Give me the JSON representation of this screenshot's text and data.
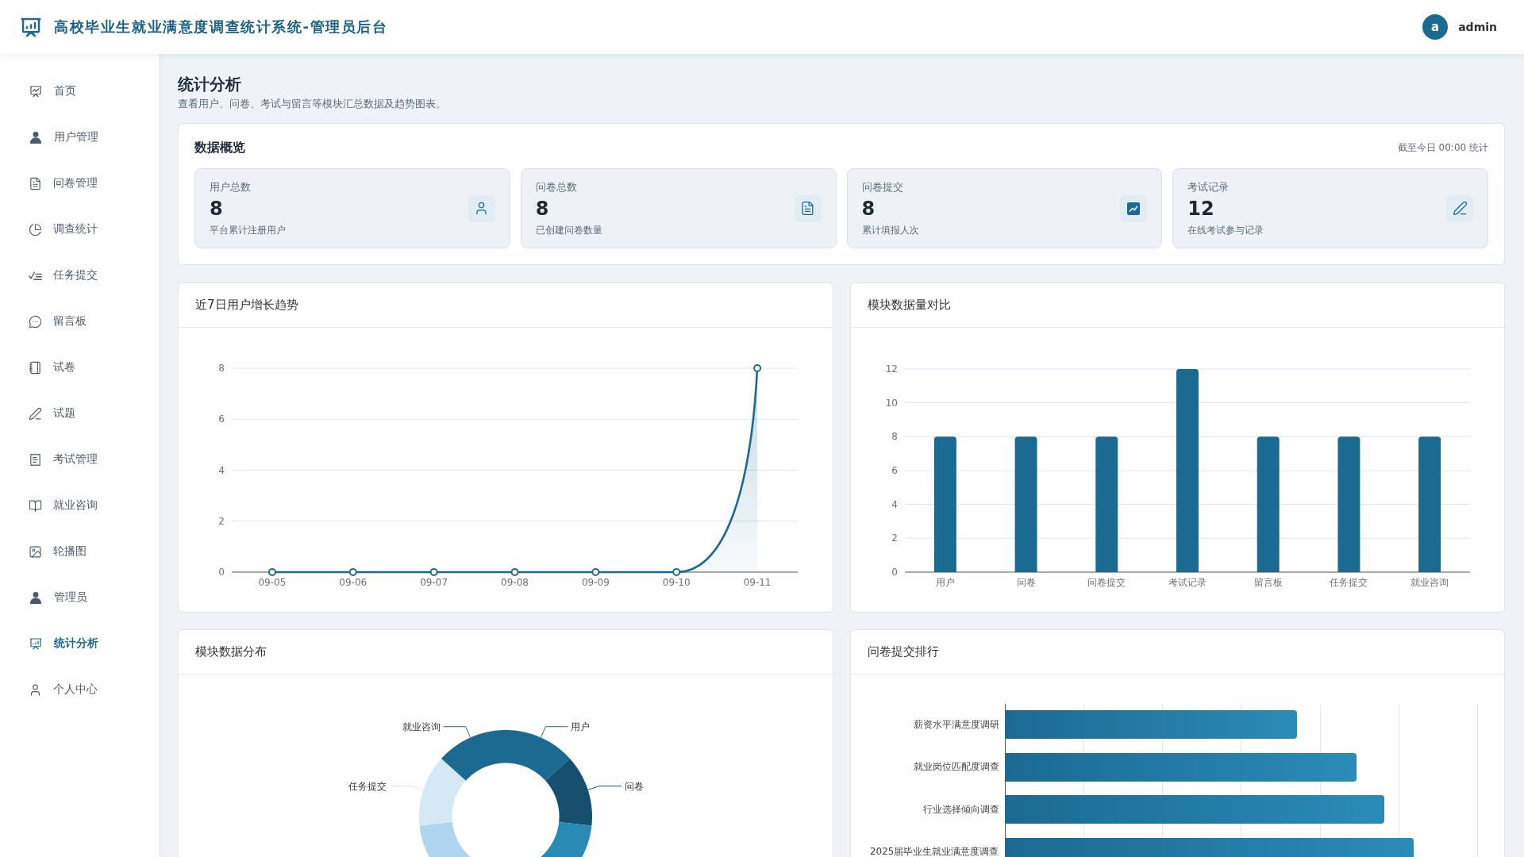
{
  "header": {
    "title": "高校毕业生就业满意度调查统计系统-管理员后台",
    "user": {
      "avatar": "a",
      "name": "admin"
    }
  },
  "sidebar": {
    "items": [
      {
        "label": "首页",
        "selected": false
      },
      {
        "label": "用户管理",
        "selected": false
      },
      {
        "label": "问卷管理",
        "selected": false
      },
      {
        "label": "调查统计",
        "selected": false
      },
      {
        "label": "任务提交",
        "selected": false
      },
      {
        "label": "留言板",
        "selected": false
      },
      {
        "label": "试卷",
        "selected": false
      },
      {
        "label": "试题",
        "selected": false
      },
      {
        "label": "考试管理",
        "selected": false
      },
      {
        "label": "就业咨询",
        "selected": false
      },
      {
        "label": "轮播图",
        "selected": false
      },
      {
        "label": "管理员",
        "selected": false
      },
      {
        "label": "统计分析",
        "selected": true
      },
      {
        "label": "个人中心",
        "selected": false
      }
    ]
  },
  "page": {
    "title": "统计分析",
    "subtitle": "查看用户、问卷、考试与留言等模块汇总数据及趋势图表。"
  },
  "overview": {
    "title": "数据概览",
    "note": "截至今日 00:00 统计",
    "stats": [
      {
        "label": "用户总数",
        "value": "8",
        "description": "平台累计注册用户"
      },
      {
        "label": "问卷总数",
        "value": "8",
        "description": "已创建问卷数量"
      },
      {
        "label": "问卷提交",
        "value": "8",
        "description": "累计填报人次"
      },
      {
        "label": "考试记录",
        "value": "12",
        "description": "在线考试参与记录"
      }
    ]
  },
  "user_growth": {
    "title": "近7日用户增长趋势",
    "chart_data": {
      "type": "line",
      "categories": [
        "09-05",
        "09-06",
        "09-07",
        "09-08",
        "09-09",
        "09-10",
        "09-11"
      ],
      "values": [
        0,
        0,
        0,
        0,
        0,
        0,
        8
      ],
      "ylim": [
        0,
        8
      ],
      "yticks": [
        0,
        2,
        4,
        6,
        8
      ],
      "grid": true,
      "marker": true
    }
  },
  "module_comparison": {
    "title": "模块数据量对比",
    "chart_data": {
      "type": "bar",
      "categories": [
        "用户",
        "问卷",
        "问卷提交",
        "考试记录",
        "留言板",
        "任务提交",
        "就业咨询"
      ],
      "values": [
        8,
        8,
        8,
        12,
        8,
        8,
        8
      ],
      "ylim": [
        0,
        12
      ],
      "yticks": [
        0,
        2,
        4,
        6,
        8,
        10,
        12
      ],
      "grid": true
    }
  },
  "module_distribution": {
    "title": "模块数据分布",
    "slices": [
      {
        "label": "用户",
        "color": "#1b6a91"
      },
      {
        "label": "问卷",
        "color": "#15506e"
      },
      {
        "color": "#2a8ab6"
      },
      {
        "color": "#b0d5ef"
      },
      {
        "label": "任务提交",
        "color": "#d5e8f6"
      },
      {
        "label": "就业咨询",
        "color": "#1b6a91"
      }
    ]
  },
  "submission_ranking": {
    "title": "问卷提交排行",
    "rows": [
      {
        "label": "薪资水平满意度调研"
      },
      {
        "label": "就业岗位匹配度调查"
      },
      {
        "label": "行业选择倾向调查"
      },
      {
        "label": "2025届毕业生就业满意度调查"
      }
    ]
  }
}
